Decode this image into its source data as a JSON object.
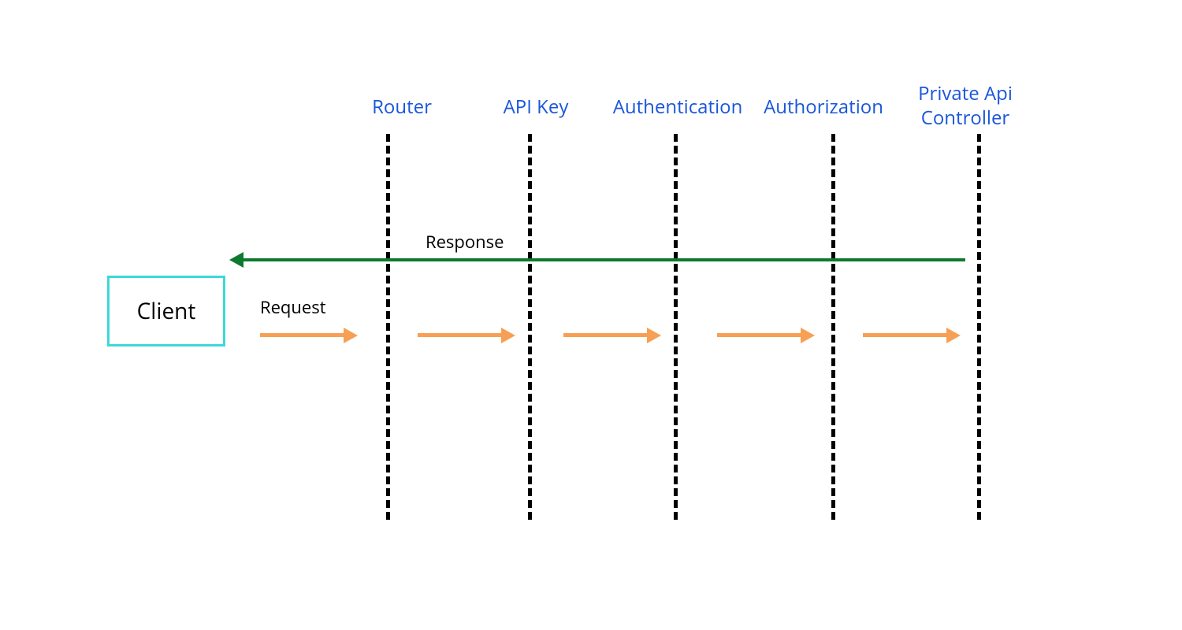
{
  "client": {
    "label": "Client"
  },
  "stages": {
    "router": "Router",
    "apiKey": "API Key",
    "authentication": "Authentication",
    "authorization": "Authorization",
    "controllerLine1": "Private Api",
    "controllerLine2": "Controller"
  },
  "labels": {
    "response": "Response",
    "request": "Request"
  },
  "colors": {
    "stageLabel": "#1a56db",
    "clientBorder": "#3ed8d8",
    "responseArrow": "#0b7a2e",
    "requestArrow": "#f7a055",
    "dashedLine": "#000000"
  }
}
